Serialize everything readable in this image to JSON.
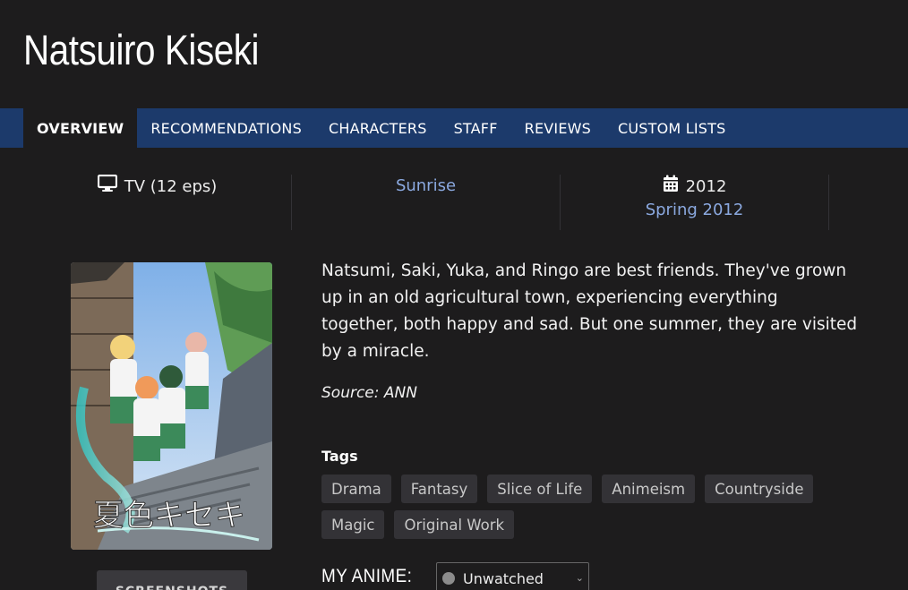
{
  "title": "Natsuiro Kiseki",
  "tabs": [
    "OVERVIEW",
    "RECOMMENDATIONS",
    "CHARACTERS",
    "STAFF",
    "REVIEWS",
    "CUSTOM LISTS"
  ],
  "info": {
    "format": "TV (12 eps)",
    "studio": "Sunrise",
    "year": "2012",
    "season": "Spring 2012",
    "format_icon": "tv-icon",
    "date_icon": "calendar-icon"
  },
  "cover": {
    "logo_text": "夏色キセキ"
  },
  "screenshots_label": "SCREENSHOTS",
  "synopsis": "Natsumi, Saki, Yuka, and Ringo are best friends. They've grown up in an old agricultural town, experiencing everything together, both happy and sad. But one summer, they are visited by a miracle.",
  "source": "Source: ANN",
  "tags_label": "Tags",
  "tags": [
    "Drama",
    "Fantasy",
    "Slice of Life",
    "Animeism",
    "Countryside",
    "Magic",
    "Original Work"
  ],
  "my_anime": {
    "label": "MY ANIME:",
    "status": "Unwatched",
    "status_color": "#8c8c8c"
  },
  "colors": {
    "background": "#1d1c1d",
    "tab_bar": "#1c3a6b",
    "link": "#8ba9e0",
    "tag_bg": "#333236"
  }
}
